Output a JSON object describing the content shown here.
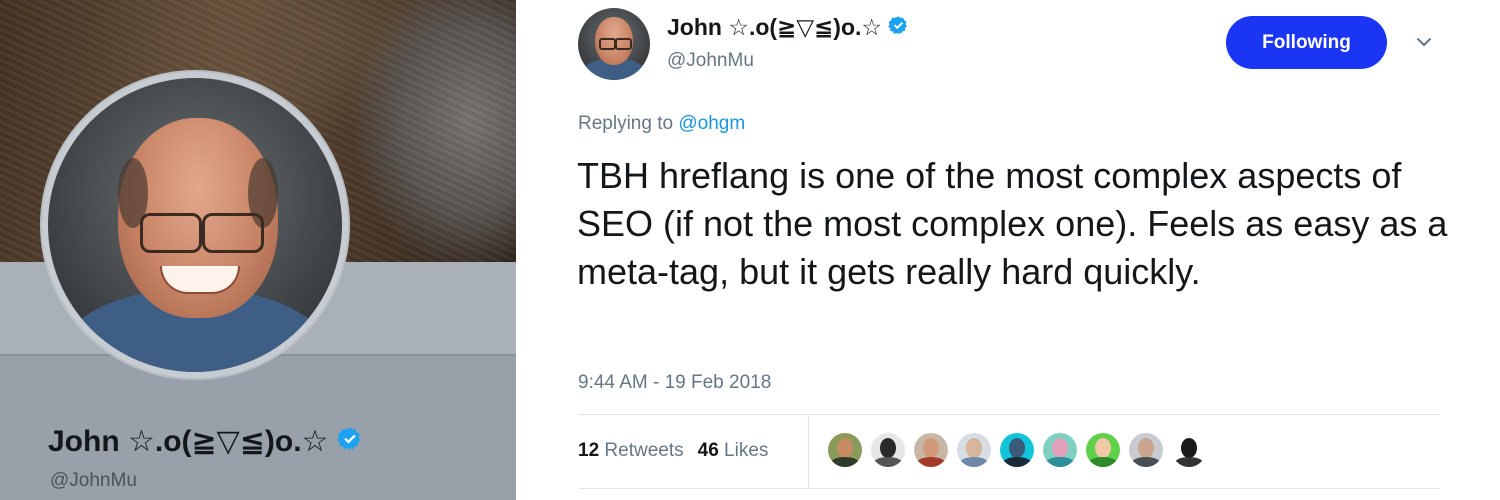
{
  "profile": {
    "name": "John ☆.o(≧▽≦)o.☆",
    "handle": "@JohnMu"
  },
  "tweet": {
    "author_name": "John ☆.o(≧▽≦)o.☆",
    "author_handle": "@JohnMu",
    "follow_label": "Following",
    "reply_prefix": "Replying to",
    "reply_handle": "@ohgm",
    "text": "TBH hreflang is one of the most complex aspects of SEO (if not the most complex one). Feels as easy as a meta-tag, but it gets really hard quickly.",
    "timestamp": "9:44 AM - 19 Feb 2018",
    "retweets_count": "12",
    "retweets_label": "Retweets",
    "likes_count": "46",
    "likes_label": "Likes"
  },
  "colors": {
    "accent": "#1b35f5",
    "link": "#1b95e0",
    "verified": "#1da1f2"
  },
  "icons": {
    "verified": "verified-badge-icon",
    "more": "chevron-down-icon"
  }
}
